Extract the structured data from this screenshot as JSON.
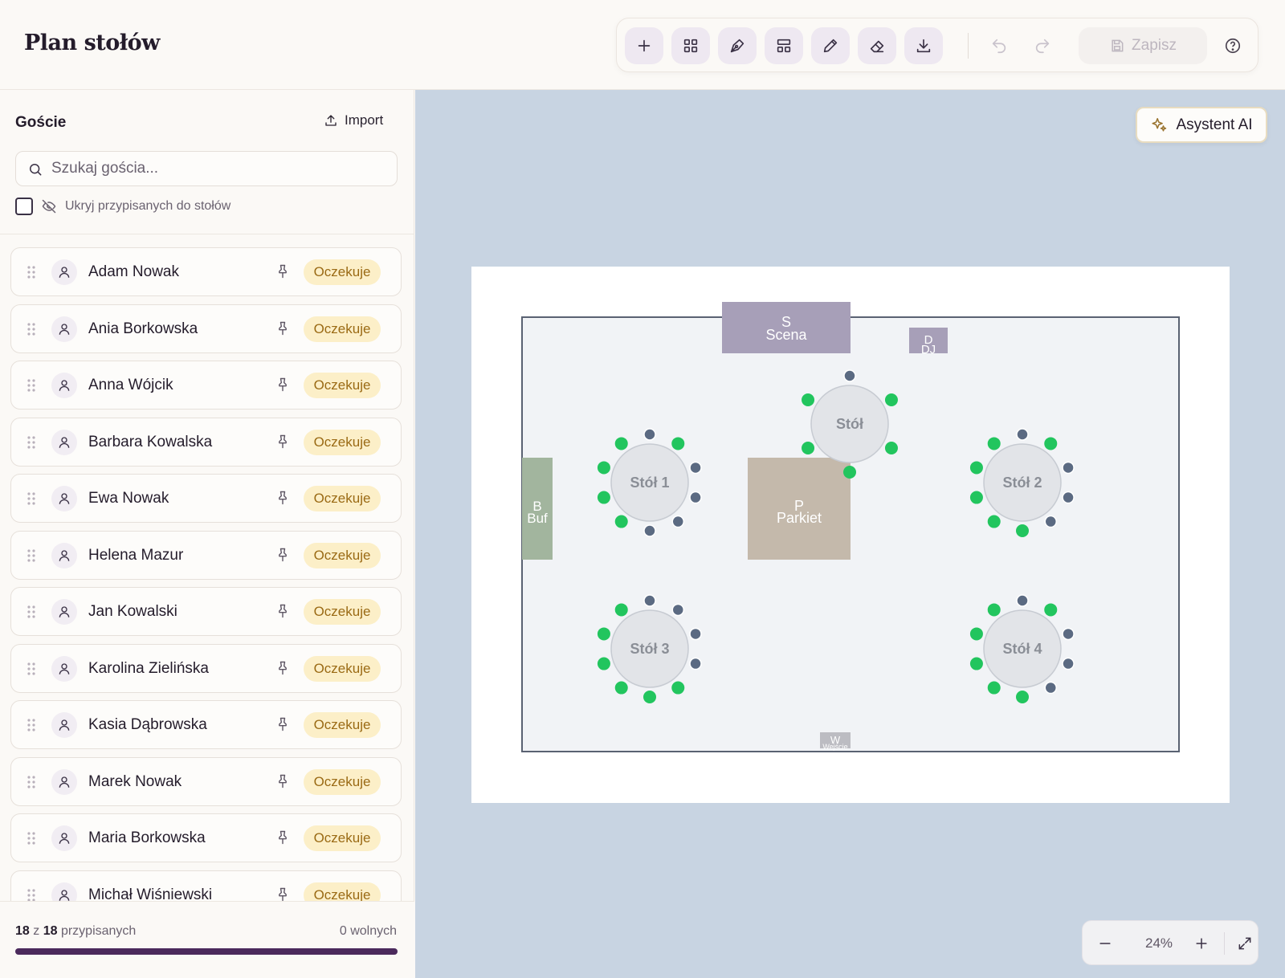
{
  "header": {
    "title": "Plan stołów"
  },
  "toolbar": {
    "buttons": [
      "add-icon",
      "grid-icon",
      "pen-tool-icon",
      "layout-icon",
      "pencil-icon",
      "eraser-icon",
      "download-icon"
    ],
    "save_label": "Zapisz"
  },
  "sidebar": {
    "title": "Goście",
    "import_label": "Import",
    "search_placeholder": "Szukaj gościa...",
    "hide_assigned_label": "Ukryj przypisanych do stołów",
    "guests": [
      {
        "name": "Adam Nowak",
        "status": "Oczekuje"
      },
      {
        "name": "Ania Borkowska",
        "status": "Oczekuje"
      },
      {
        "name": "Anna Wójcik",
        "status": "Oczekuje"
      },
      {
        "name": "Barbara Kowalska",
        "status": "Oczekuje"
      },
      {
        "name": "Ewa Nowak",
        "status": "Oczekuje"
      },
      {
        "name": "Helena Mazur",
        "status": "Oczekuje"
      },
      {
        "name": "Jan Kowalski",
        "status": "Oczekuje"
      },
      {
        "name": "Karolina Zielińska",
        "status": "Oczekuje"
      },
      {
        "name": "Kasia Dąbrowska",
        "status": "Oczekuje"
      },
      {
        "name": "Marek Nowak",
        "status": "Oczekuje"
      },
      {
        "name": "Maria Borkowska",
        "status": "Oczekuje"
      },
      {
        "name": "Michał Wiśniewski",
        "status": "Oczekuje"
      }
    ],
    "footer": {
      "assigned_count": "18",
      "total_count": "18",
      "of_text": "z",
      "assigned_suffix": "przypisanych",
      "free_text": "0 wolnych",
      "progress_fraction": 1.0
    }
  },
  "canvas": {
    "ai_button_label": "Asystent AI",
    "zoom_level": "24%",
    "zones": [
      {
        "id": "stage",
        "initial": "S",
        "label": "Scena",
        "color": "#a79fb8"
      },
      {
        "id": "dj",
        "initial": "D",
        "label": "DJ",
        "color": "#a79fb8"
      },
      {
        "id": "buffet",
        "initial": "B",
        "label": "Buf",
        "color": "#a2b59e"
      },
      {
        "id": "dance-floor",
        "initial": "P",
        "label": "Parkiet",
        "color": "#c4b9ab"
      },
      {
        "id": "entrance",
        "initial": "W",
        "label": "Wejście",
        "color": "#bcbcc2"
      }
    ],
    "tables": [
      {
        "id": "table-top",
        "label": "Stół"
      },
      {
        "id": "table-1",
        "label": "Stół 1"
      },
      {
        "id": "table-2",
        "label": "Stół 2"
      },
      {
        "id": "table-3",
        "label": "Stół 3"
      },
      {
        "id": "table-4",
        "label": "Stół 4"
      }
    ],
    "colors": {
      "seat_free": "#22c55e",
      "seat_taken": "#5b6a82",
      "table_fill": "#e2e4e8"
    }
  }
}
